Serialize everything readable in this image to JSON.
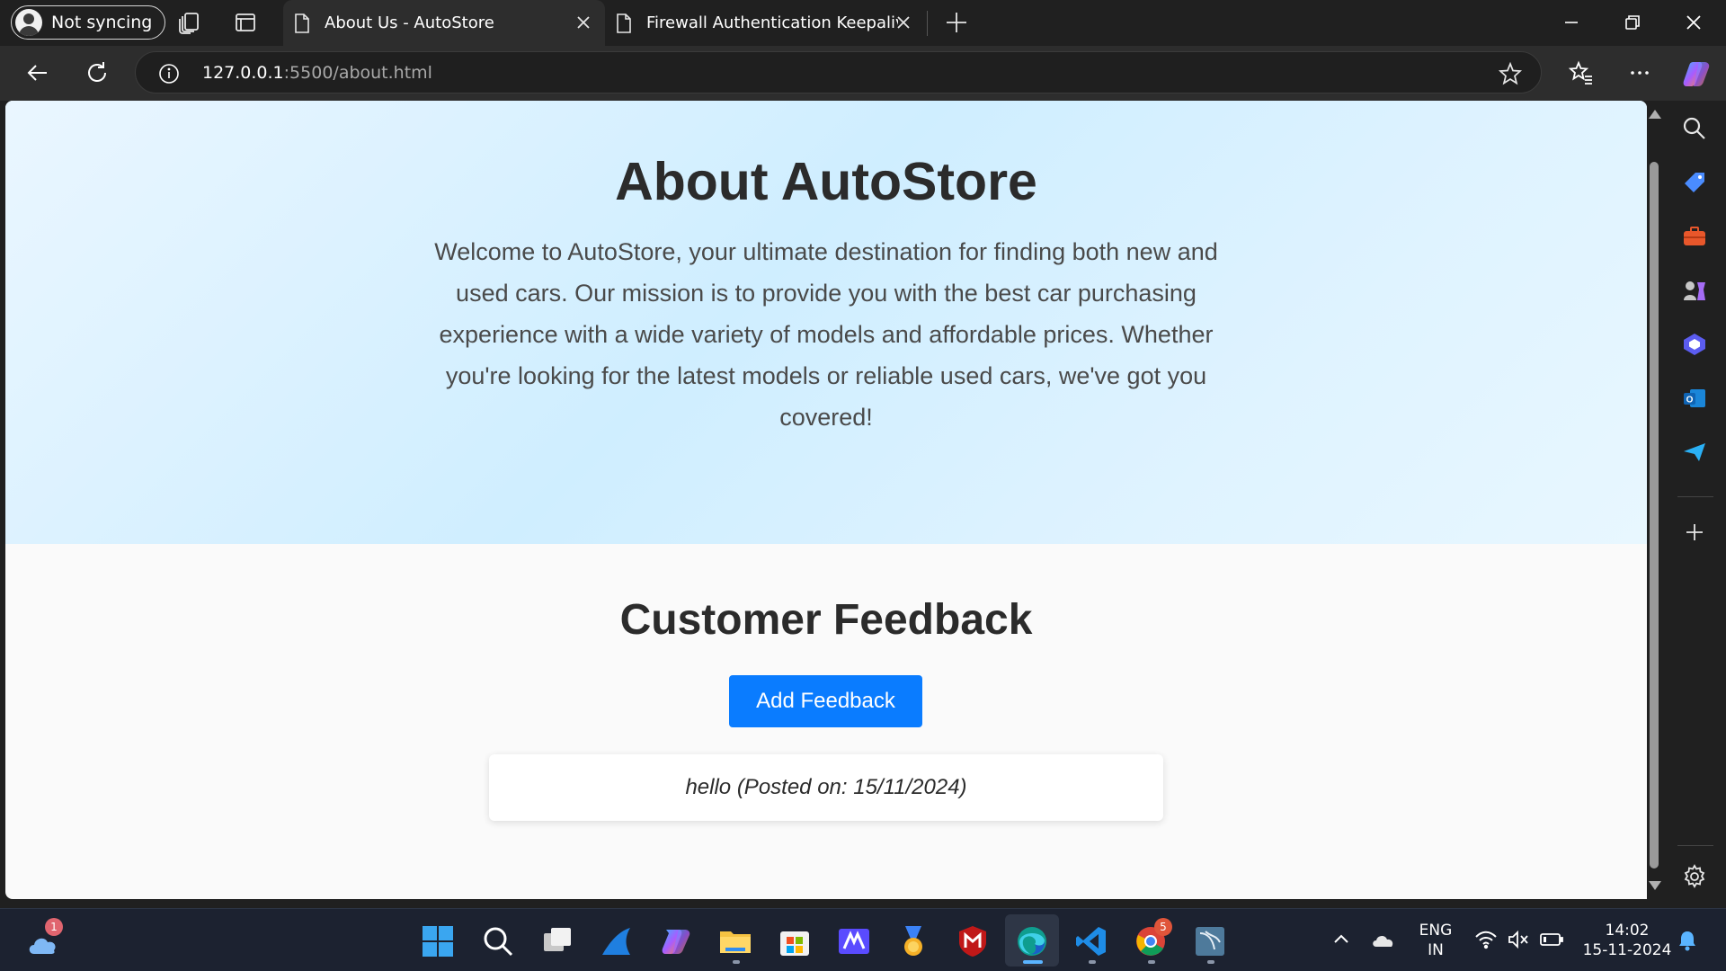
{
  "browser": {
    "profile_label": "Not syncing",
    "tabs": [
      {
        "title": "About Us - AutoStore",
        "active": true
      },
      {
        "title": "Firewall Authentication Keepalive",
        "active": false
      }
    ],
    "address": {
      "host": "127.0.0.1",
      "path": ":5500/about.html"
    }
  },
  "page": {
    "hero": {
      "title": "About AutoStore",
      "description": "Welcome to AutoStore, your ultimate destination for finding both new and used cars. Our mission is to provide you with the best car purchasing experience with a wide variety of models and affordable prices. Whether you're looking for the latest models or reliable used cars, we've got you covered!"
    },
    "feedback": {
      "heading": "Customer Feedback",
      "add_button": "Add Feedback",
      "entries": [
        {
          "text": "hello (Posted on: 15/11/2024)"
        }
      ]
    }
  },
  "taskbar": {
    "weather_badge": "1",
    "chrome_badge": "5",
    "language_line1": "ENG",
    "language_line2": "IN",
    "time": "14:02",
    "date": "15-11-2024"
  },
  "colors": {
    "accent_button": "#0a7cff",
    "hero_gradient_mid": "#cfeeff",
    "page_background": "#fafafa"
  }
}
